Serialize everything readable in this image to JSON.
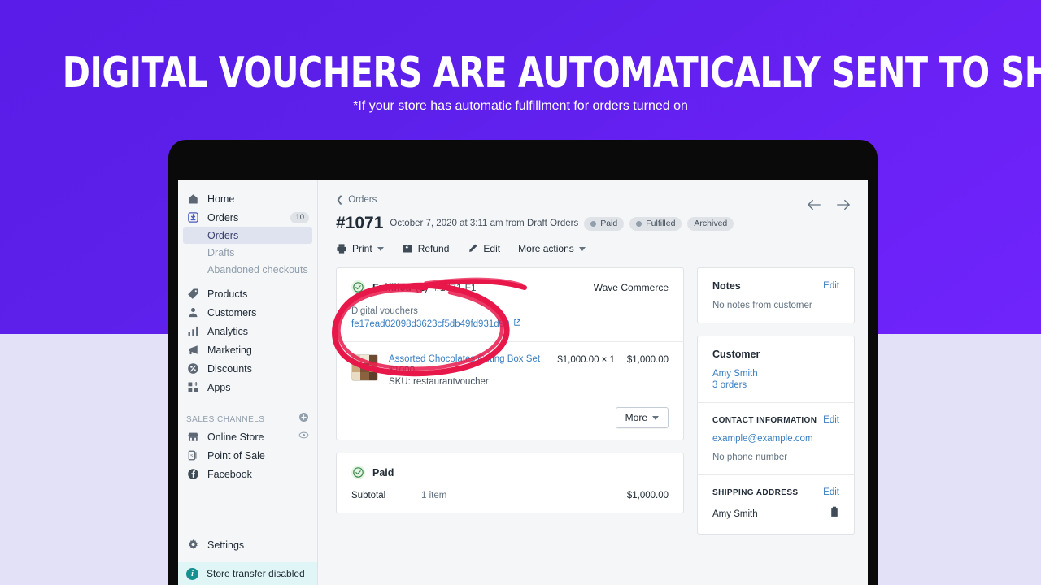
{
  "hero": {
    "headline": "DIGITAL VOUCHERS ARE AUTOMATICALLY SENT TO SHOPPERS*",
    "subhead": "*If your store has automatic fulfillment for orders turned on",
    "bg_top": "#5f1fee",
    "bg_bottom": "#e3e1f7"
  },
  "sidebar": {
    "items": [
      {
        "label": "Home",
        "icon": "home-icon"
      },
      {
        "label": "Orders",
        "icon": "orders-icon",
        "badge": "10"
      },
      {
        "label": "Products",
        "icon": "tag-icon"
      },
      {
        "label": "Customers",
        "icon": "person-icon"
      },
      {
        "label": "Analytics",
        "icon": "bar-chart-icon"
      },
      {
        "label": "Marketing",
        "icon": "megaphone-icon"
      },
      {
        "label": "Discounts",
        "icon": "discount-icon"
      },
      {
        "label": "Apps",
        "icon": "apps-icon"
      }
    ],
    "suborders": [
      {
        "label": "Orders",
        "active": true
      },
      {
        "label": "Drafts",
        "active": false
      },
      {
        "label": "Abandoned checkouts",
        "active": false
      }
    ],
    "channels_title": "SALES CHANNELS",
    "channels": [
      {
        "label": "Online Store",
        "icon": "store-icon",
        "trailing": "eye-icon"
      },
      {
        "label": "Point of Sale",
        "icon": "pos-icon"
      },
      {
        "label": "Facebook",
        "icon": "facebook-icon"
      }
    ],
    "settings_label": "Settings",
    "store_transfer": "Store transfer disabled"
  },
  "order": {
    "breadcrumb": "Orders",
    "number": "#1071",
    "meta": "October 7, 2020 at 3:11 am from Draft Orders",
    "badges": [
      {
        "label": "Paid",
        "dot": true
      },
      {
        "label": "Fulfilled",
        "dot": true
      },
      {
        "label": "Archived",
        "dot": false
      }
    ],
    "toolbar": [
      {
        "label": "Print",
        "icon": "printer-icon",
        "caret": true
      },
      {
        "label": "Refund",
        "icon": "refund-icon",
        "caret": false
      },
      {
        "label": "Edit",
        "icon": "pencil-icon",
        "caret": false
      },
      {
        "label": "More actions",
        "icon": "",
        "caret": true
      }
    ]
  },
  "fulfillment": {
    "status": "Fulfilled",
    "count": "(1)",
    "id": "#1071-F1",
    "location": "Wave Commerce",
    "voucher_label": "Digital vouchers",
    "voucher_code": "fe17ead02098d3623cf5db49fd931d90",
    "item": {
      "name": "Assorted Chocolates Gifting Box Set",
      "variant": "$1000",
      "sku": "SKU: restaurantvoucher",
      "unit_price": "$1,000.00 × 1",
      "line_total": "$1,000.00"
    },
    "more_label": "More"
  },
  "payment": {
    "status": "Paid",
    "subtotal_label": "Subtotal",
    "subtotal_items": "1 item",
    "subtotal_amount": "$1,000.00"
  },
  "panels": {
    "notes": {
      "title": "Notes",
      "edit": "Edit",
      "body": "No notes from customer"
    },
    "customer": {
      "title": "Customer",
      "name": "Amy Smith",
      "orders": "3 orders"
    },
    "contact": {
      "title": "CONTACT INFORMATION",
      "edit": "Edit",
      "email": "example@example.com",
      "phone": "No phone number"
    },
    "shipping": {
      "title": "SHIPPING ADDRESS",
      "edit": "Edit",
      "name": "Amy Smith"
    }
  },
  "annotation": {
    "color": "#e8174a",
    "shape": "hand-drawn-ellipse"
  }
}
